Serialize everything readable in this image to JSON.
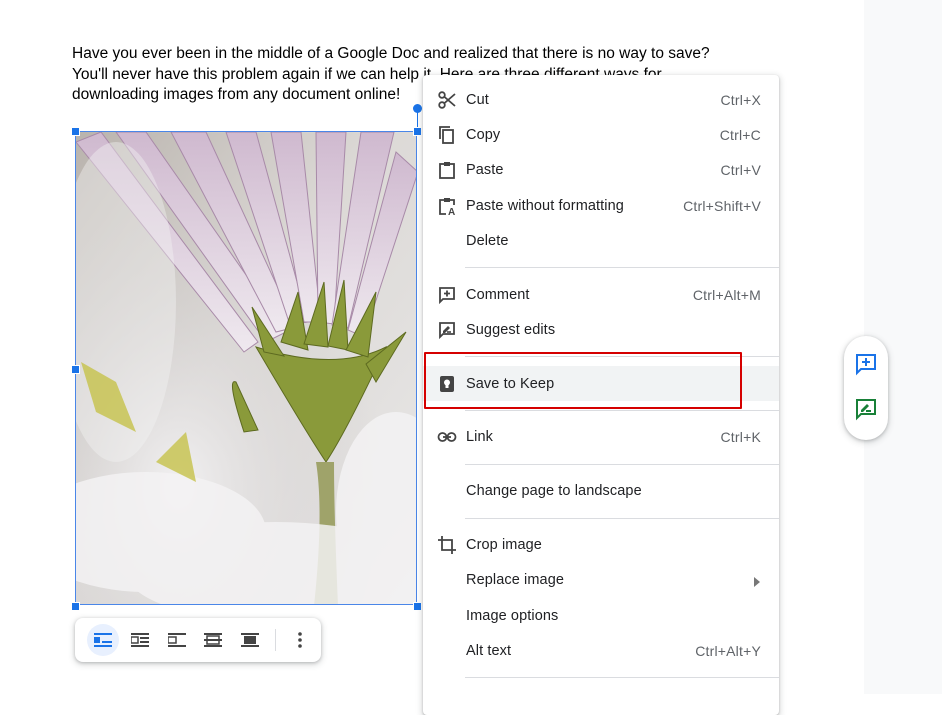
{
  "document": {
    "lines": [
      "Have you ever been in the middle of a Google Doc and realized that there is no way to save?",
      "You'll never have this problem again if we can help it. Here are three different ways for",
      "downloading images from any document online!"
    ]
  },
  "context_menu": {
    "items": [
      {
        "label": "Cut",
        "shortcut": "Ctrl+X",
        "icon": "scissors-icon"
      },
      {
        "label": "Copy",
        "shortcut": "Ctrl+C",
        "icon": "copy-icon"
      },
      {
        "label": "Paste",
        "shortcut": "Ctrl+V",
        "icon": "clipboard-icon"
      },
      {
        "label": "Paste without formatting",
        "shortcut": "Ctrl+Shift+V",
        "icon": "clipboard-text-icon"
      },
      {
        "label": "Delete",
        "shortcut": "",
        "icon": ""
      },
      {
        "label": "Comment",
        "shortcut": "Ctrl+Alt+M",
        "icon": "add-comment-icon"
      },
      {
        "label": "Suggest edits",
        "shortcut": "",
        "icon": "rate-review-icon"
      },
      {
        "label": "Save to Keep",
        "shortcut": "",
        "icon": "keep-icon"
      },
      {
        "label": "Link",
        "shortcut": "Ctrl+K",
        "icon": "link-icon"
      },
      {
        "label": "Change page to landscape",
        "shortcut": "",
        "icon": ""
      },
      {
        "label": "Crop image",
        "shortcut": "",
        "icon": "crop-icon"
      },
      {
        "label": "Replace image",
        "shortcut": "",
        "icon": "chevron-right-icon"
      },
      {
        "label": "Image options",
        "shortcut": "",
        "icon": ""
      },
      {
        "label": "Alt text",
        "shortcut": "Ctrl+Alt+Y",
        "icon": ""
      }
    ],
    "highlight_color": "#d50000"
  },
  "image_toolbar": {
    "buttons": [
      "inline-icon",
      "wrap-text-icon",
      "break-text-icon",
      "behind-text-icon",
      "in-front-of-text-icon",
      "more-options-icon"
    ]
  },
  "side_actions": [
    "add-comment-icon",
    "suggest-edits-icon"
  ],
  "colors": {
    "accent": "#1a73e8",
    "text": "#202124",
    "shortcut": "#5f6368"
  }
}
